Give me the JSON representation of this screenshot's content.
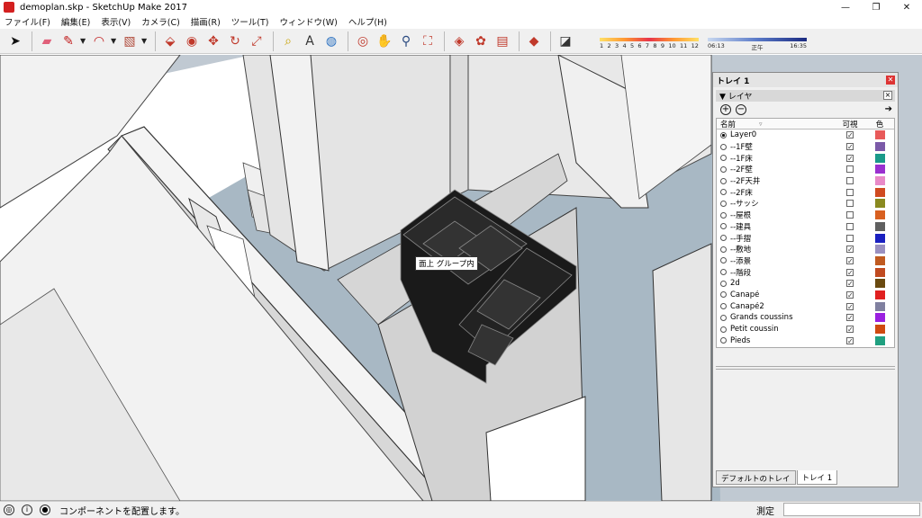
{
  "window": {
    "title": "demoplan.skp - SketchUp Make 2017",
    "app_icon": "sketchup-icon"
  },
  "window_controls": {
    "minimize": "—",
    "restore": "❐",
    "close": "✕"
  },
  "menu": [
    "ファイル(F)",
    "編集(E)",
    "表示(V)",
    "カメラ(C)",
    "描画(R)",
    "ツール(T)",
    "ウィンドウ(W)",
    "ヘルプ(H)"
  ],
  "toolbar": {
    "tools": [
      {
        "name": "select-icon",
        "glyph": "➤",
        "color": "#111"
      },
      {
        "name": "eraser-icon",
        "glyph": "▰",
        "color": "#e0607a"
      },
      {
        "name": "pencil-icon",
        "glyph": "✎",
        "color": "#c01a1a"
      },
      {
        "name": "arc-icon",
        "glyph": "◠",
        "color": "#c01a1a"
      },
      {
        "name": "rectangle-icon",
        "glyph": "▧",
        "color": "#b04a3a"
      },
      {
        "name": "push-pull-icon",
        "glyph": "⬙",
        "color": "#c0392b"
      },
      {
        "name": "follow-me-icon",
        "glyph": "◉",
        "color": "#c0392b"
      },
      {
        "name": "move-icon",
        "glyph": "✥",
        "color": "#c0392b"
      },
      {
        "name": "rotate-icon",
        "glyph": "↻",
        "color": "#c0392b"
      },
      {
        "name": "scale-icon",
        "glyph": "⤢",
        "color": "#c0392b"
      },
      {
        "name": "tape-measure-icon",
        "glyph": "⌕",
        "color": "#c8a000"
      },
      {
        "name": "text-icon",
        "glyph": "A",
        "color": "#333"
      },
      {
        "name": "paint-bucket-icon",
        "glyph": "◍",
        "color": "#2a70c0"
      },
      {
        "name": "orbit-icon",
        "glyph": "◎",
        "color": "#c0392b"
      },
      {
        "name": "pan-icon",
        "glyph": "✋",
        "color": "#c8a000"
      },
      {
        "name": "zoom-icon",
        "glyph": "⚲",
        "color": "#2a4a80"
      },
      {
        "name": "zoom-extents-icon",
        "glyph": "⛶",
        "color": "#c0392b"
      },
      {
        "name": "warehouse-icon",
        "glyph": "◈",
        "color": "#c0392b"
      },
      {
        "name": "extension-warehouse-icon",
        "glyph": "✿",
        "color": "#c0392b"
      },
      {
        "name": "layout-icon",
        "glyph": "▤",
        "color": "#c0392b"
      },
      {
        "name": "ruby-icon",
        "glyph": "◆",
        "color": "#c0392b"
      },
      {
        "name": "shadows-icon",
        "glyph": "◪",
        "color": "#333"
      }
    ],
    "shadow_scale": {
      "months": [
        "1",
        "2",
        "3",
        "4",
        "5",
        "6",
        "7",
        "8",
        "9",
        "10",
        "11",
        "12"
      ]
    },
    "time_scale": {
      "start": "06:13",
      "mid": "正午",
      "end": "16:35"
    }
  },
  "viewport": {
    "tooltip": "面上 グループ内",
    "colors": {
      "floor": "#a8b8c4",
      "wall": "#ececec",
      "wall_shade": "#c9c9c9",
      "sofa": "#1a1a1a"
    }
  },
  "tray": {
    "title": "トレイ 1",
    "panel_title": "▼ レイヤ",
    "add_icon": "plus-circle-icon",
    "remove_icon": "minus-circle-icon",
    "details_icon": "details-arrow-icon",
    "columns": {
      "name": "名前",
      "visible": "可視",
      "color": "色"
    },
    "layers": [
      {
        "name": "Layer0",
        "active": true,
        "visible": true,
        "color": "#e85a5a"
      },
      {
        "name": "--1F壁",
        "active": false,
        "visible": true,
        "color": "#7b5aa8"
      },
      {
        "name": "--1F床",
        "active": false,
        "visible": true,
        "color": "#1a9a8a"
      },
      {
        "name": "--2F壁",
        "active": false,
        "visible": false,
        "color": "#9a30d0"
      },
      {
        "name": "--2F天井",
        "active": false,
        "visible": false,
        "color": "#e88ac8"
      },
      {
        "name": "--2F床",
        "active": false,
        "visible": false,
        "color": "#d04a20"
      },
      {
        "name": "--サッシ",
        "active": false,
        "visible": false,
        "color": "#8a8a20"
      },
      {
        "name": "--屋根",
        "active": false,
        "visible": false,
        "color": "#d86020"
      },
      {
        "name": "--建具",
        "active": false,
        "visible": false,
        "color": "#606060"
      },
      {
        "name": "--手摺",
        "active": false,
        "visible": false,
        "color": "#1a20c0"
      },
      {
        "name": "--敷地",
        "active": false,
        "visible": true,
        "color": "#9a90c0"
      },
      {
        "name": "--添景",
        "active": false,
        "visible": true,
        "color": "#c05a20"
      },
      {
        "name": "--階段",
        "active": false,
        "visible": true,
        "color": "#c04a20"
      },
      {
        "name": "2d",
        "active": false,
        "visible": true,
        "color": "#6a4a10"
      },
      {
        "name": "Canapé",
        "active": false,
        "visible": true,
        "color": "#e02020"
      },
      {
        "name": "Canapé2",
        "active": false,
        "visible": true,
        "color": "#8080a0"
      },
      {
        "name": "Grands coussins",
        "active": false,
        "visible": true,
        "color": "#9a20e0"
      },
      {
        "name": "Petit coussin",
        "active": false,
        "visible": true,
        "color": "#d04a10"
      },
      {
        "name": "Pieds",
        "active": false,
        "visible": true,
        "color": "#20a080"
      }
    ],
    "tabs": [
      "デフォルトのトレイ",
      "トレイ 1"
    ]
  },
  "status": {
    "icons": [
      "geolocation-icon",
      "info-icon",
      "user-icon"
    ],
    "message": "コンポーネントを配置します。",
    "measure_label": "測定",
    "measure_value": ""
  }
}
